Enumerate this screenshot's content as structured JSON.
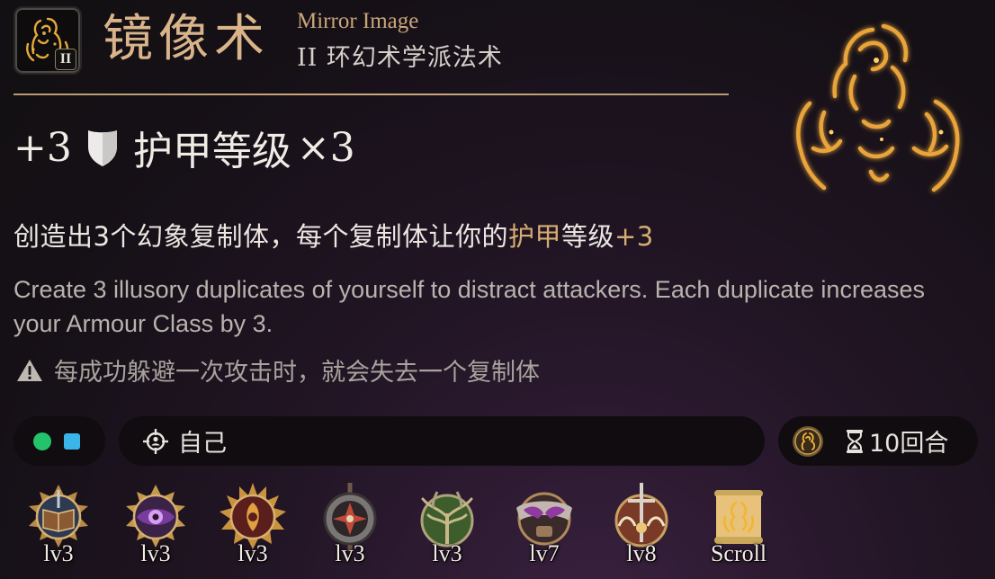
{
  "spell": {
    "name_cn": "镜像术",
    "name_en": "Mirror Image",
    "level_badge": "II",
    "school": "II 环幻术学派法术",
    "icon": "mirror-image-spell-icon"
  },
  "effect": {
    "bonus": "+3",
    "stat": "护甲等级",
    "multiplier": "×3",
    "icon": "shield-icon"
  },
  "description_cn": {
    "prefix": "创造出3个幻象复制体，每个复制体让你的",
    "highlight1": "护甲",
    "middle": "等级",
    "highlight2": "+3"
  },
  "description_en": "Create 3 illusory duplicates of yourself to distract attackers. Each duplicate increases your Armour Class by 3.",
  "note": "每成功躲避一次攻击时，就会失去一个复制体",
  "resources": {
    "action_color": "#22c36a",
    "spell_slot_color": "#3bb5e8"
  },
  "target": {
    "icon": "target-crosshair-icon",
    "text": "自己"
  },
  "duration": {
    "text": "10回合",
    "icon": "hourglass-icon"
  },
  "classes": [
    {
      "icon": "wizard-class-icon",
      "label": "lv3"
    },
    {
      "icon": "sorcerer-class-icon",
      "label": "lv3"
    },
    {
      "icon": "warlock-class-icon",
      "label": "lv3"
    },
    {
      "icon": "cleric-class-icon",
      "label": "lv3"
    },
    {
      "icon": "druid-class-icon",
      "label": "lv3"
    },
    {
      "icon": "bard-class-icon",
      "label": "lv7"
    },
    {
      "icon": "paladin-class-icon",
      "label": "lv8"
    },
    {
      "icon": "scroll-icon",
      "label": "Scroll"
    }
  ],
  "colors": {
    "title_gold": "#d9b48a",
    "highlight_gold": "#d6ac72",
    "background": "#1b1319"
  }
}
